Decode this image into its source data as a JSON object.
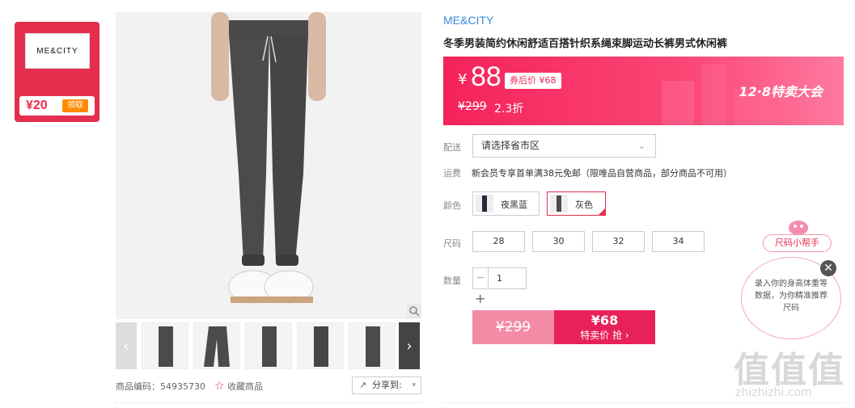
{
  "coupon": {
    "brand_logo_text": "ME&CITY",
    "amount": "¥20",
    "claim_label": "领取"
  },
  "gallery": {
    "prev_arrow": "‹",
    "next_arrow": "›",
    "thumbnail_count": 5
  },
  "meta": {
    "code_label": "商品编码：",
    "code": "54935730",
    "favorite_label": "收藏商品",
    "share_label": "分享到:"
  },
  "product": {
    "brand": "ME&CITY",
    "title": "冬季男装简约休闲舒适百搭针织系绳束脚运动长裤男式休闲裤",
    "price_symbol": "¥",
    "price": "88",
    "coupon_price": "券后价 ¥68",
    "original_price": "¥299",
    "discount": "2.3折",
    "promo": "12·8特卖大会"
  },
  "options": {
    "delivery_label": "配送",
    "delivery_placeholder": "请选择省市区",
    "shipping_label": "运费",
    "shipping_text": "新会员专享首单满38元免邮（限唯品自营商品，部分商品不可用）",
    "color_label": "颜色",
    "colors": [
      "夜黑蓝",
      "灰色"
    ],
    "selected_color": "灰色",
    "size_label": "尺码",
    "sizes": [
      "28",
      "30",
      "32",
      "34"
    ],
    "qty_label": "数量",
    "qty_value": "1",
    "qty_minus": "−",
    "qty_plus": "+"
  },
  "buy": {
    "original_price": "¥299",
    "sale_price": "¥68",
    "sale_label": "特卖价 抢 ›"
  },
  "size_helper": {
    "tag": "尺码小帮手",
    "message": "录入你的身高体重等数据，为你精准推荐尺码",
    "close": "✕"
  },
  "watermark": {
    "logo": "值值值",
    "site": "zhizhizhi.com"
  },
  "colors": {
    "accent": "#e52d4d",
    "price_banner": "#f4235a",
    "brand_blue": "#3a8ad8"
  }
}
